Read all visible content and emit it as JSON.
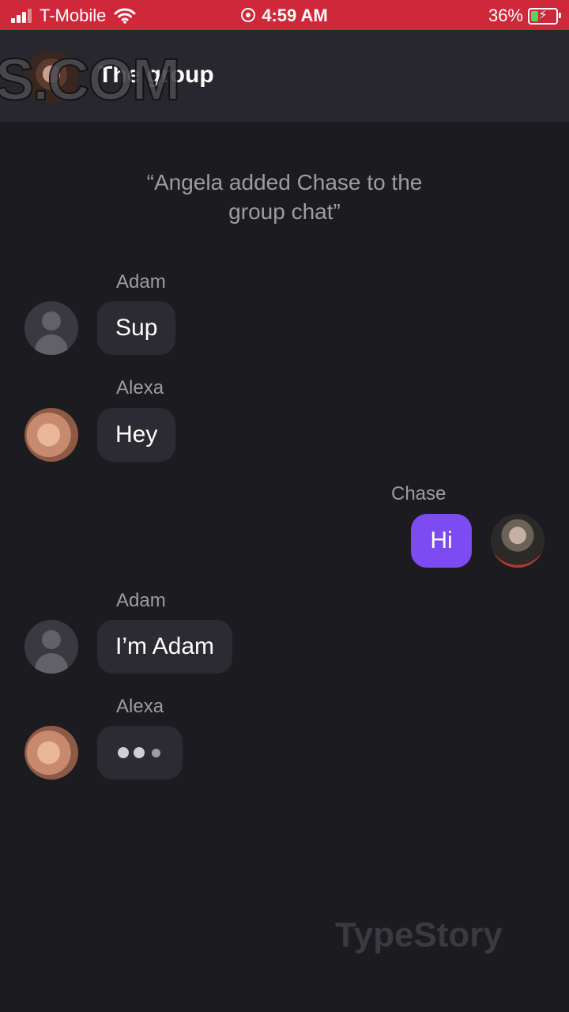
{
  "status_bar": {
    "carrier": "T-Mobile",
    "time": "4:59 AM",
    "battery_percent": "36%",
    "battery_level": 0.36,
    "color": "#d0283a"
  },
  "header": {
    "title": "The group",
    "watermark": "S.COM"
  },
  "chat": {
    "system_message": "“Angela added Chase to the group chat”",
    "messages": [
      {
        "sender": "Adam",
        "text": "Sup"
      },
      {
        "sender": "Alexa",
        "text": "Hey"
      },
      {
        "sender": "Chase",
        "text": "Hi"
      },
      {
        "sender": "Adam",
        "text": "I’m Adam"
      },
      {
        "sender": "Alexa",
        "typing": true
      }
    ]
  },
  "watermark_bottom": "TypeStory",
  "colors": {
    "background": "#1c1b20",
    "header": "#28272d",
    "bubble_incoming": "#2c2b31",
    "bubble_outgoing": "#7c4bf4"
  },
  "icons": [
    "signal-icon",
    "wifi-icon",
    "alarm-icon",
    "battery-icon",
    "default-avatar-icon"
  ]
}
